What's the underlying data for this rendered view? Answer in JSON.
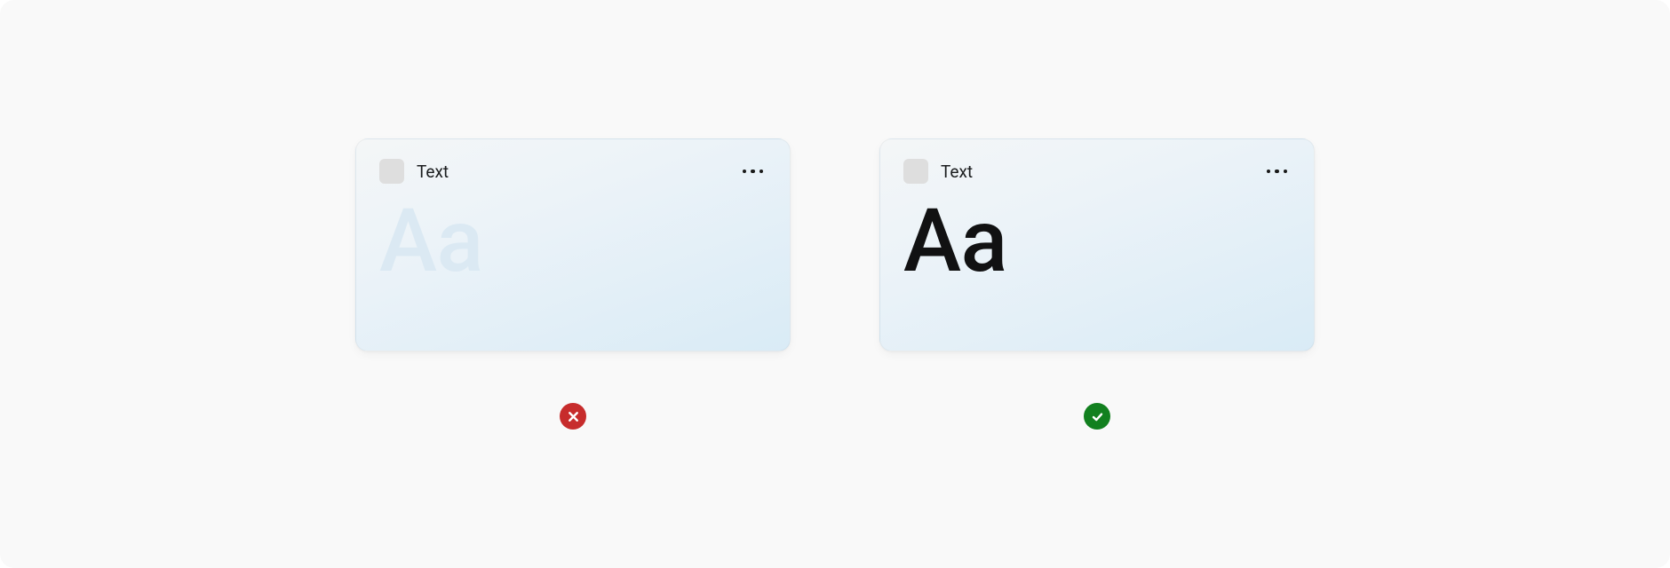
{
  "examples": {
    "bad": {
      "title": "Text",
      "sample_text": "Aa",
      "status": "incorrect"
    },
    "good": {
      "title": "Text",
      "sample_text": "Aa",
      "status": "correct"
    }
  },
  "colors": {
    "bad_badge": "#c72c2c",
    "good_badge": "#12801f",
    "low_contrast_text": "#dbe9f3",
    "high_contrast_text": "#111112",
    "card_gradient_start": "#f4f6f7",
    "card_gradient_end": "#d9ebf6"
  }
}
